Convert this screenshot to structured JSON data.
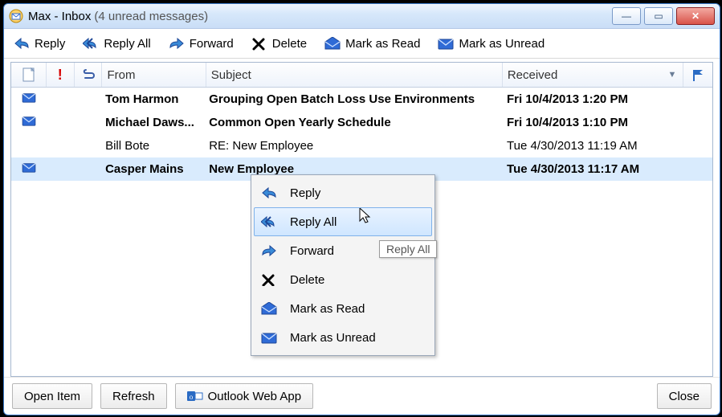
{
  "window": {
    "title_main": "Max - Inbox",
    "title_paren": "(4 unread messages)"
  },
  "toolbar": {
    "reply": "Reply",
    "reply_all": "Reply All",
    "forward": "Forward",
    "delete": "Delete",
    "mark_read": "Mark as Read",
    "mark_unread": "Mark as Unread"
  },
  "columns": {
    "from": "From",
    "subject": "Subject",
    "received": "Received"
  },
  "messages": [
    {
      "unread": true,
      "from": "Tom Harmon",
      "subject": "Grouping Open Batch Loss Use Environments",
      "received": "Fri 10/4/2013 1:20 PM",
      "selected": false
    },
    {
      "unread": true,
      "from": "Michael Daws...",
      "subject": "Common Open Yearly Schedule",
      "received": "Fri 10/4/2013 1:10 PM",
      "selected": false
    },
    {
      "unread": false,
      "from": "Bill Bote",
      "subject": "RE: New Employee",
      "received": "Tue 4/30/2013 11:19 AM",
      "selected": false
    },
    {
      "unread": true,
      "from": "Casper Mains",
      "subject": "New Employee",
      "received": "Tue 4/30/2013 11:17 AM",
      "selected": true
    }
  ],
  "context_menu": {
    "items": [
      {
        "label": "Reply",
        "icon": "reply-icon"
      },
      {
        "label": "Reply All",
        "icon": "reply-all-icon",
        "highlight": true
      },
      {
        "label": "Forward",
        "icon": "forward-icon"
      },
      {
        "label": "Delete",
        "icon": "delete-icon"
      },
      {
        "label": "Mark as Read",
        "icon": "mail-open-icon"
      },
      {
        "label": "Mark as Unread",
        "icon": "mail-closed-icon"
      }
    ],
    "tooltip": "Reply All"
  },
  "footer": {
    "open_item": "Open Item",
    "refresh": "Refresh",
    "owa": "Outlook Web App",
    "close": "Close"
  }
}
